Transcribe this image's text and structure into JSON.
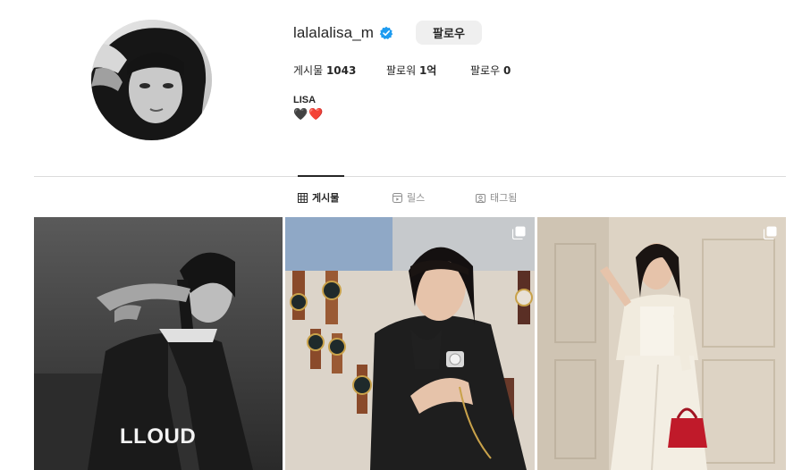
{
  "profile": {
    "username": "lalalalisa_m",
    "follow_label": "팔로우",
    "posts_label": "게시물",
    "posts_count": "1043",
    "followers_label": "팔로워",
    "followers_count": "1억",
    "following_label": "팔로우",
    "following_count": "0",
    "bio_name": "LISA",
    "bio_text": "🖤❤️"
  },
  "tabs": [
    {
      "label": "게시물",
      "icon": "grid-icon",
      "active": true
    },
    {
      "label": "릴스",
      "icon": "reels-icon",
      "active": false
    },
    {
      "label": "태그됨",
      "icon": "tagged-icon",
      "active": false
    }
  ],
  "posts": [
    {
      "watermark": "LLOUD",
      "style": "monochrome",
      "multi": false
    },
    {
      "watermark": "",
      "style": "watch-campaign",
      "multi": true
    },
    {
      "watermark": "",
      "style": "cream-suit",
      "multi": true
    }
  ],
  "colors": {
    "verified": "#1d9bf0",
    "follow_button_bg": "#efefef",
    "divider": "#dbdbdb"
  }
}
